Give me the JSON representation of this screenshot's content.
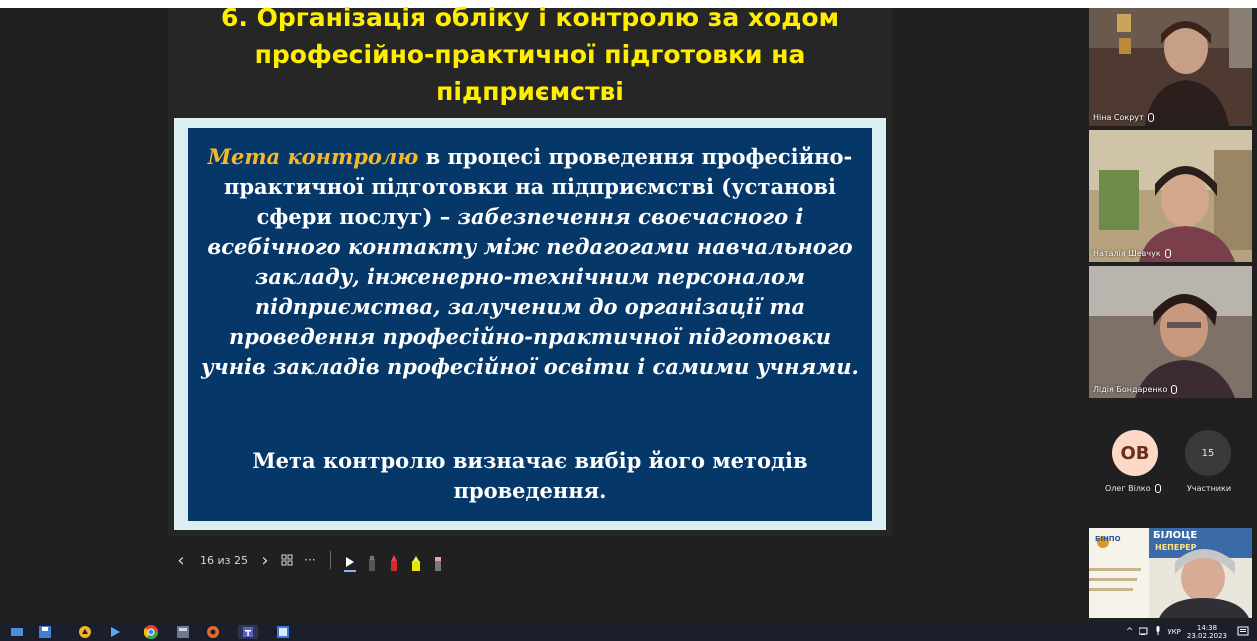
{
  "slide": {
    "title_lines": [
      "6. Організація обліку і контролю за ходом",
      "професійно-практичної підготовки на",
      "підприємстві"
    ],
    "goal_term": "Мета  контролю",
    "para1_rest": " в процесі проведення професійно-практичної підготовки на підприємстві (установі сфери послуг) –",
    "para1_italic": "забезпечення своєчасного і всебічного контакту між педагогами навчального закладу, інженерно-технічним персоналом підприємства, залученим до організації та проведення професійно-практичної підготовки учнів закладів професійної освіти і самими учнями.",
    "para2": "Мета контролю визначає вибір його методів проведення."
  },
  "slide_nav": {
    "prev": "‹",
    "counter": "16 из 25",
    "next": "›",
    "more": "···"
  },
  "participants": [
    {
      "name": "Ніна Сокрут"
    },
    {
      "name": "Наталія Шевчук"
    },
    {
      "name": "Лідія Бондаренко"
    }
  ],
  "current_user": {
    "initials": "ОВ",
    "name": "Олег Вілко"
  },
  "participants_panel": {
    "count": "15",
    "label": "Участники"
  },
  "shared_banner": {
    "brand": "БІНПО",
    "headline": "БІЛОЦЕ",
    "subline": "НЕПЕРЕР"
  },
  "taskbar": {
    "lang": "УКР",
    "time": "14:38",
    "date": "23.02.2023",
    "chevron": "^"
  },
  "colors": {
    "title_yellow": "#ffee00",
    "content_bg": "#053768",
    "goal_orange": "#f3b82f"
  }
}
